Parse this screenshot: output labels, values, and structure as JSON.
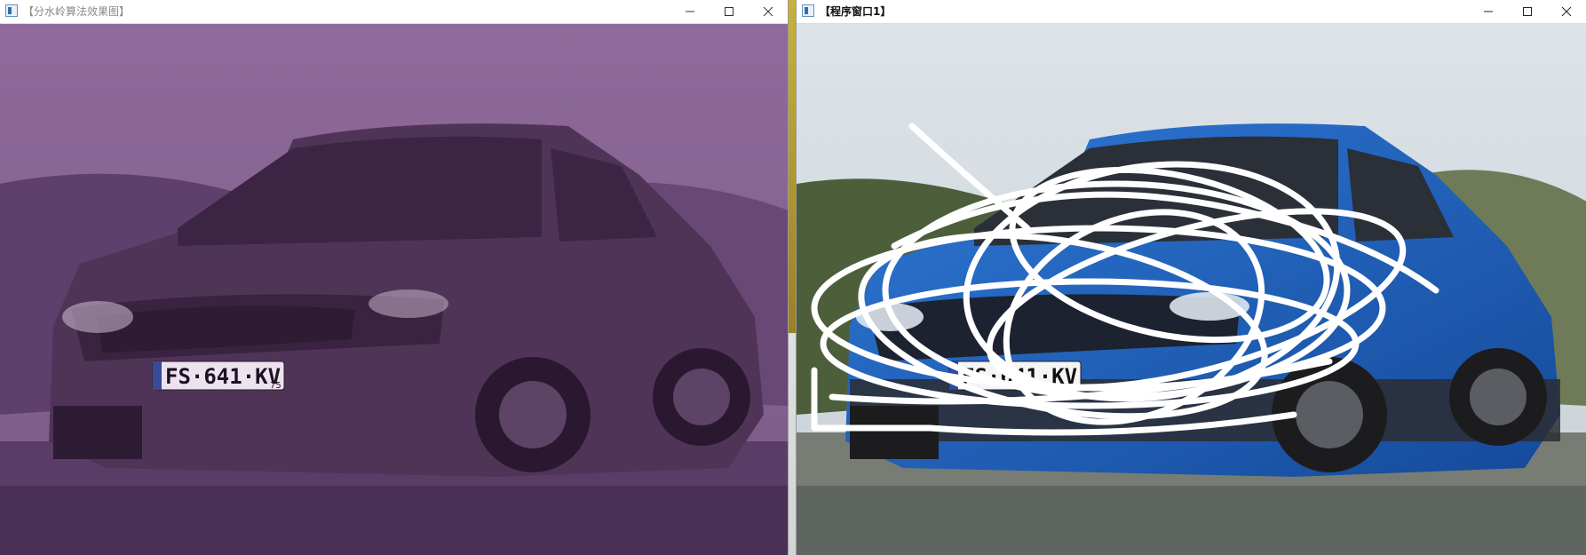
{
  "left_window": {
    "title": "【分水岭算法效果图】",
    "image_alt": "Purple-tinted photo of a compact SUV"
  },
  "right_window": {
    "title": "【程序窗口1】",
    "image_alt": "Photo of a blue SUV with white scribble marks drawn over the front"
  },
  "plate": {
    "left": "FS·641·KV",
    "left_sub": "75",
    "right": "FS·641·KV"
  },
  "background_text": "",
  "colors": {
    "tint": "#7a4a85",
    "car_blue": "#1f5fb8",
    "scribble": "#ffffff",
    "desktop": "#b8860b"
  },
  "icons": {
    "app": "app-window-icon",
    "minimize": "minimize-icon",
    "maximize": "maximize-icon",
    "close": "close-icon"
  }
}
